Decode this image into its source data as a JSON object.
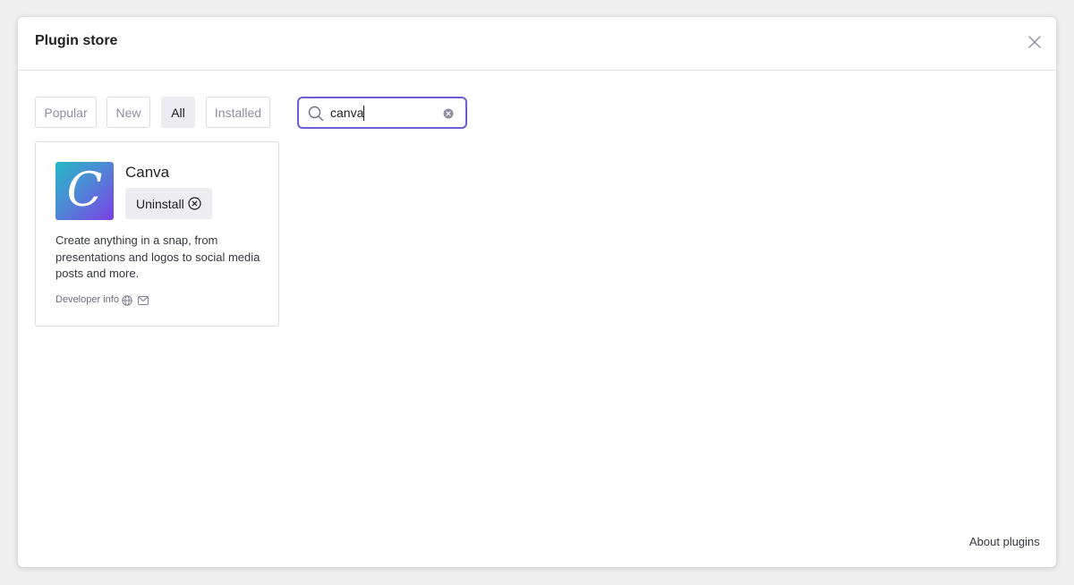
{
  "modal": {
    "title": "Plugin store"
  },
  "filters": {
    "tabs": [
      {
        "label": "Popular",
        "active": false
      },
      {
        "label": "New",
        "active": false
      },
      {
        "label": "All",
        "active": true
      },
      {
        "label": "Installed",
        "active": false
      }
    ]
  },
  "search": {
    "value": "canva",
    "icon": "search-icon",
    "clear_icon": "clear-icon"
  },
  "plugins": [
    {
      "name": "Canva",
      "logo_letter": "C",
      "action_label": "Uninstall",
      "action_icon": "x-circle-icon",
      "description": "Create anything in a snap, from presentations and logos to social media posts and more.",
      "developer_label": "Developer info",
      "developer_icons": [
        "globe-icon",
        "mail-icon"
      ]
    }
  ],
  "footer": {
    "about_label": "About plugins"
  },
  "colors": {
    "accent": "#6c5dd3",
    "active_tab_bg": "#ececf1",
    "logo_gradient_start": "#23b8c5",
    "logo_gradient_end": "#7b3fe4"
  }
}
